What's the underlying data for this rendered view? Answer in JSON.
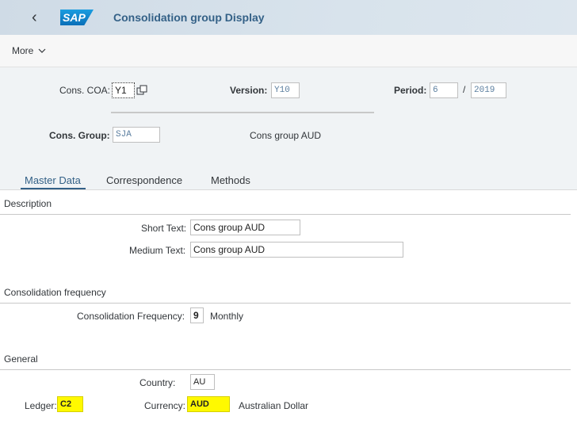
{
  "shell": {
    "title": "Consolidation group Display",
    "logo_text": "SAP",
    "back_icon": "chevron-left-icon"
  },
  "toolbar": {
    "more_label": "More",
    "more_icon": "chevron-down-icon"
  },
  "header": {
    "cons_coa_label": "Cons. COA:",
    "cons_coa_value": "Y1",
    "version_label": "Version:",
    "version_value": "Y10",
    "period_label": "Period:",
    "period_value": "6",
    "period_sep": "/",
    "year_value": "2019",
    "cons_group_label": "Cons. Group:",
    "cons_group_value": "SJA",
    "cons_group_desc": "Cons group AUD"
  },
  "tabs": [
    {
      "label": "Master Data",
      "active": true
    },
    {
      "label": "Correspondence",
      "active": false
    },
    {
      "label": "Methods",
      "active": false
    }
  ],
  "description": {
    "title": "Description",
    "short_label": "Short Text:",
    "short_value": "Cons group AUD",
    "medium_label": "Medium Text:",
    "medium_value": "Cons group AUD"
  },
  "frequency": {
    "title": "Consolidation frequency",
    "label": "Consolidation Frequency:",
    "value": "9",
    "desc": "Monthly"
  },
  "general": {
    "title": "General",
    "country_label": "Country:",
    "country_value": "AU",
    "ledger_label": "Ledger:",
    "ledger_value": "C2",
    "currency_label": "Currency:",
    "currency_value": "AUD",
    "currency_desc": "Australian Dollar"
  },
  "colors": {
    "accent": "#346187",
    "highlight": "#fff900",
    "header_bg": "#f0f3f5"
  }
}
